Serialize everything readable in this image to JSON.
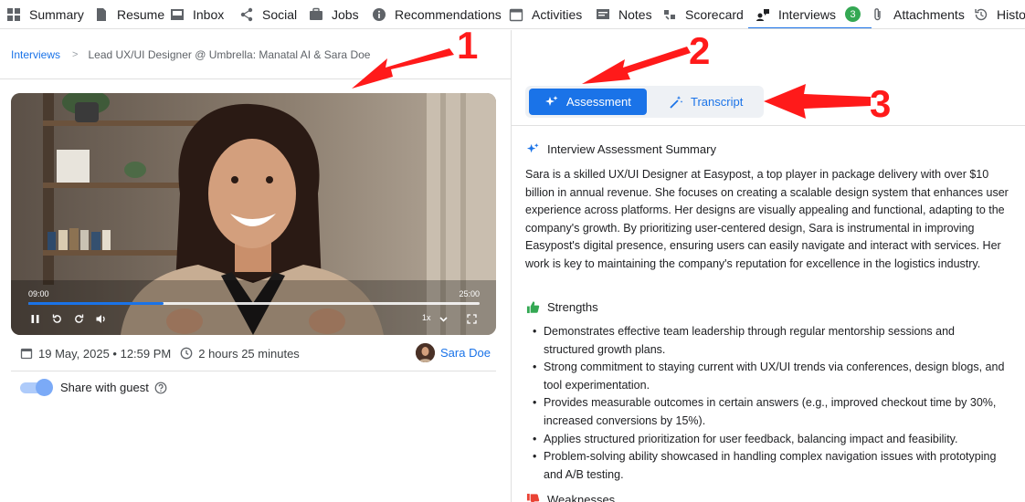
{
  "nav": {
    "items": [
      {
        "label": "Summary",
        "icon": "grid-icon"
      },
      {
        "label": "Resume",
        "icon": "document-icon"
      },
      {
        "label": "Inbox",
        "icon": "inbox-icon"
      },
      {
        "label": "Social",
        "icon": "share-icon"
      },
      {
        "label": "Jobs",
        "icon": "briefcase-icon"
      },
      {
        "label": "Recommendations",
        "icon": "info-icon"
      },
      {
        "label": "Activities",
        "icon": "calendar-icon"
      },
      {
        "label": "Notes",
        "icon": "note-icon"
      },
      {
        "label": "Scorecard",
        "icon": "scorecard-icon"
      },
      {
        "label": "Interviews",
        "icon": "interview-icon",
        "badge": "3",
        "active": true
      },
      {
        "label": "Attachments",
        "icon": "paperclip-icon"
      },
      {
        "label": "History",
        "icon": "history-icon"
      }
    ]
  },
  "breadcrumb": {
    "root": "Interviews",
    "separator": ">",
    "current": "Lead UX/UI Designer @ Umbrella: Manatal AI & Sara Doe"
  },
  "video": {
    "current_time": "09:00",
    "duration": "25:00",
    "progress_fraction": 0.3,
    "speed": "1x"
  },
  "meta": {
    "date": "19 May, 2025 • 12:59 PM",
    "duration": "2 hours 25 minutes",
    "candidate": "Sara Doe"
  },
  "share": {
    "label": "Share with guest",
    "enabled": true
  },
  "tabs": {
    "assessment": "Assessment",
    "transcript": "Transcript"
  },
  "assessment": {
    "summary_title": "Interview Assessment Summary",
    "summary": "Sara is a skilled UX/UI Designer at Easypost, a top player in package delivery with over $10 billion in annual revenue. She focuses on creating a scalable design system that enhances user experience across platforms. Her designs are visually appealing and functional, adapting to the company's growth. By prioritizing user-centered design, Sara is instrumental in improving Easypost's digital presence, ensuring users can easily navigate and interact with services. Her work is key to maintaining the company's reputation for excellence in the logistics industry.",
    "strengths_title": "Strengths",
    "strengths": [
      "Demonstrates effective team leadership through regular mentorship sessions and structured growth plans.",
      "Strong commitment to staying current with UX/UI trends via conferences, design blogs, and tool experimentation.",
      "Provides measurable outcomes in certain answers (e.g., improved checkout time by 30%, increased conversions by 15%).",
      "Applies structured prioritization for user feedback, balancing impact and feasibility.",
      "Problem-solving ability showcased in handling complex navigation issues with prototyping and A/B testing."
    ],
    "weaknesses_title": "Weaknesses"
  },
  "annotations": [
    "1",
    "2",
    "3"
  ],
  "colors": {
    "accent": "#1a73e8",
    "badge": "#34a853",
    "annotation": "#ff1a1a"
  }
}
